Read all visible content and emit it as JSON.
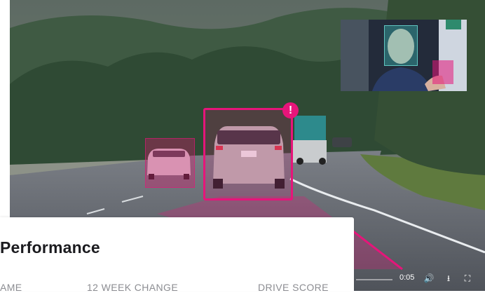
{
  "video": {
    "time": "0:05",
    "alert_badge": "!",
    "detection_color": "#e6157a",
    "face_detection_color": "#3cd2c8",
    "controls": [
      "volume-icon",
      "download-icon",
      "fullscreen-icon"
    ]
  },
  "performance_card": {
    "title": "Performance",
    "columns": [
      "AME",
      "12 WEEK CHANGE",
      "DRIVE SCORE"
    ]
  }
}
